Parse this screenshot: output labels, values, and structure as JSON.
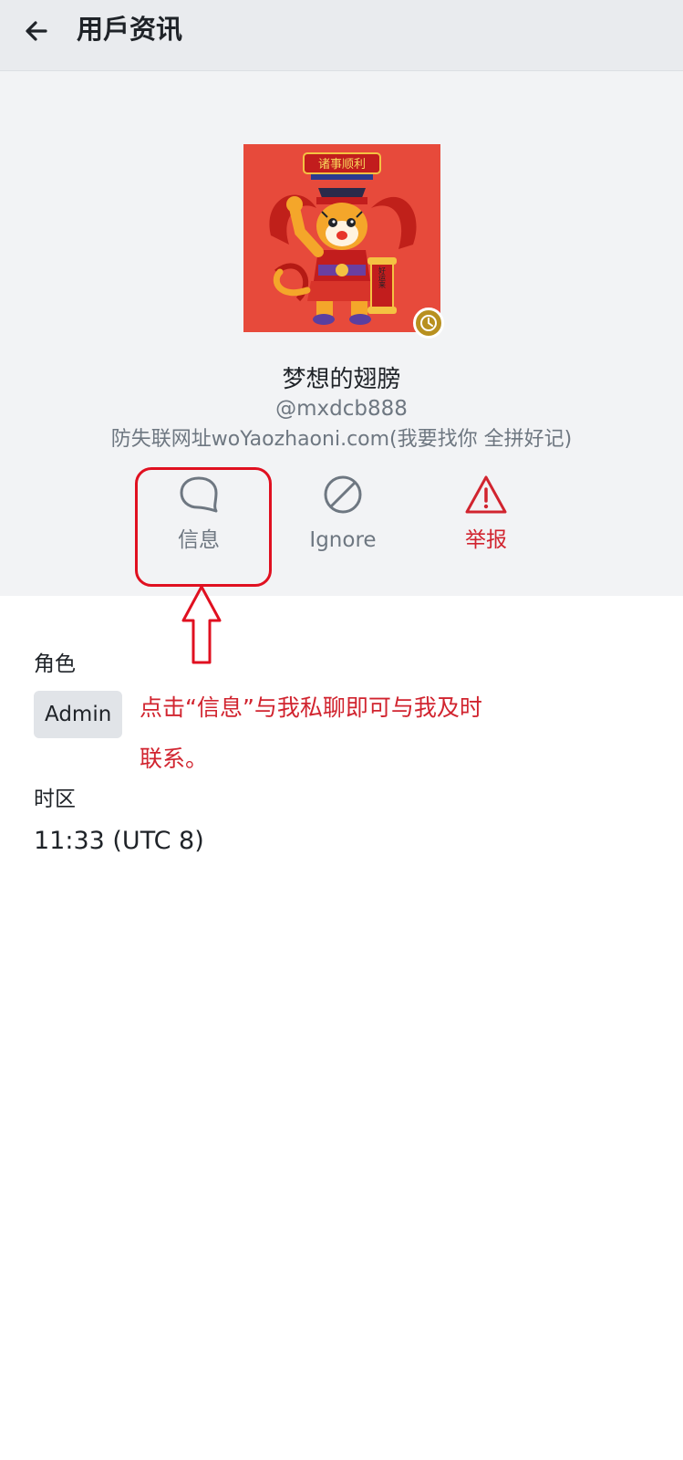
{
  "header": {
    "back_icon": "arrow-left-icon",
    "title": "用戶资讯"
  },
  "profile": {
    "avatar_icon": "tiger-avatar-image",
    "avatar_banner_text": "诸事顺利",
    "avatar_scroll_text": "好运来",
    "status_icon": "clock-icon",
    "display_name": "梦想的翅膀",
    "username": "@mxdcb888",
    "bio": "防失联网址woYaozhaoni.com(我要找你 全拼好记)"
  },
  "actions": [
    {
      "label": "信息",
      "icon": "chat-bubble-icon"
    },
    {
      "label": "Ignore",
      "icon": "ban-icon"
    },
    {
      "label": "举报",
      "icon": "warning-triangle-icon",
      "color": "#d1242f"
    }
  ],
  "info": {
    "role_label": "角色",
    "role_value": "Admin",
    "timezone_label": "时区",
    "timezone_value": "11:33 (UTC 8)"
  },
  "annotation": {
    "note": "点击“信息”与我私聊即可与我及时联系。",
    "color": "#e01020"
  }
}
